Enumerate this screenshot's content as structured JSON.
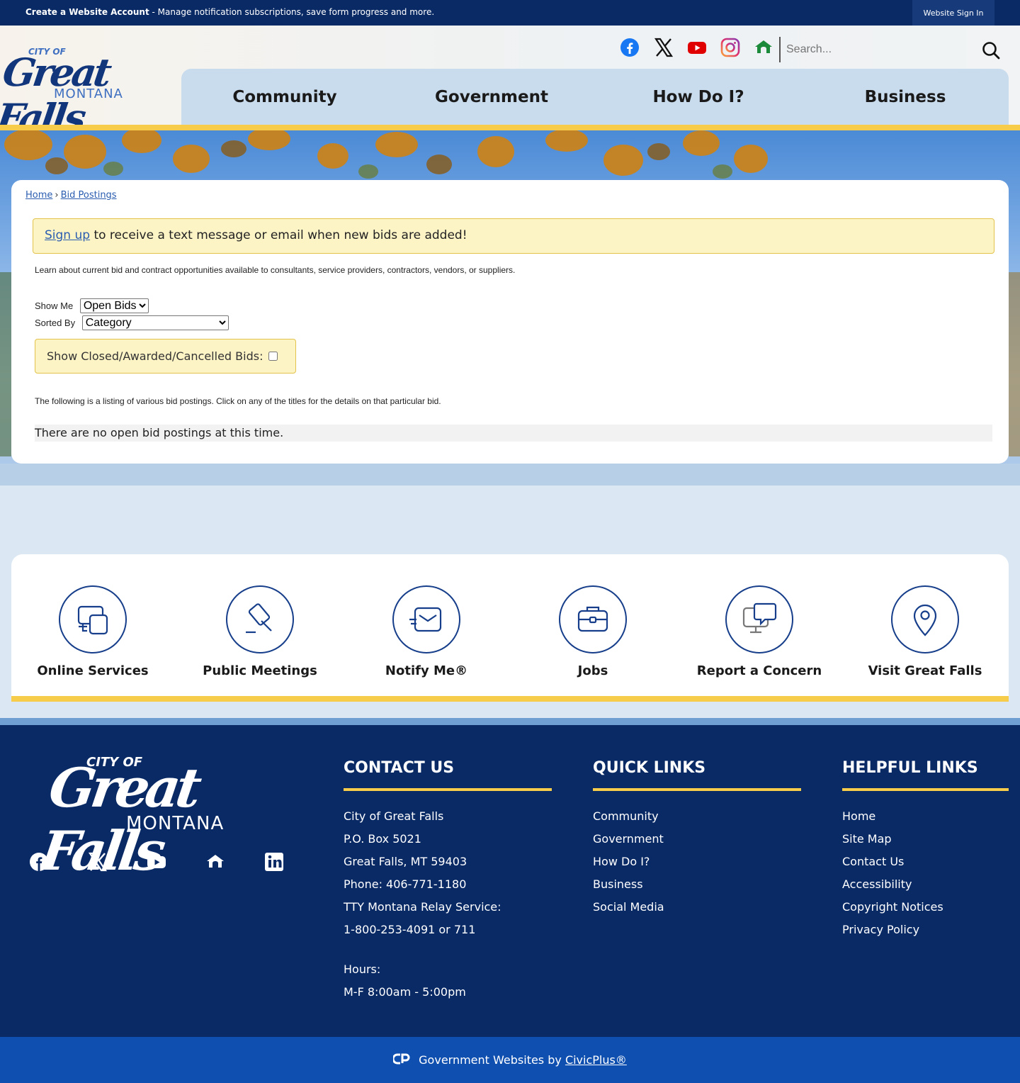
{
  "topbar": {
    "create_account": "Create a Website Account",
    "message": " - Manage notification subscriptions, save form progress and more.",
    "signin": "Website Sign In"
  },
  "logo": {
    "city_of": "CITY OF",
    "name": "Great Falls",
    "state": "MONTANA"
  },
  "social_top": [
    "facebook-icon",
    "x-icon",
    "youtube-icon",
    "instagram-icon",
    "nextdoor-icon"
  ],
  "search": {
    "placeholder": "Search..."
  },
  "nav": {
    "items": [
      "Community",
      "Government",
      "How Do I?",
      "Business"
    ]
  },
  "breadcrumb": {
    "home": "Home",
    "sep": "›",
    "current": "Bid Postings"
  },
  "alert": {
    "link": "Sign up",
    "text": " to receive a text message or email when new bids are added!"
  },
  "intro": "Learn about current bid and contract opportunities available to consultants, service providers, contractors, vendors, or suppliers.",
  "filters": {
    "show_me_label": "Show Me",
    "show_me_value": "Open Bids",
    "sorted_by_label": "Sorted By",
    "sorted_by_value": "Category",
    "closed_label": "Show Closed/Awarded/Cancelled Bids:"
  },
  "listing_text": "The following is a listing of various bid postings. Click on any of the titles for the details on that particular bid.",
  "no_bids": "There are no open bid postings at this time.",
  "quick_links": [
    {
      "label": "Online Services",
      "icon": "devices-icon"
    },
    {
      "label": "Public Meetings",
      "icon": "gavel-icon"
    },
    {
      "label": "Notify Me®",
      "icon": "envelope-icon"
    },
    {
      "label": "Jobs",
      "icon": "briefcase-icon"
    },
    {
      "label": "Report a Concern",
      "icon": "monitor-chat-icon"
    },
    {
      "label": "Visit Great Falls",
      "icon": "map-pin-icon"
    }
  ],
  "footer": {
    "logo": {
      "city_of": "CITY OF",
      "name": "Great Falls",
      "state": "MONTANA"
    },
    "social": [
      "facebook-icon",
      "x-icon",
      "youtube-icon",
      "nextdoor-icon",
      "linkedin-icon"
    ],
    "contact": {
      "title": "CONTACT US",
      "lines": [
        "City of Great Falls",
        "P.O. Box 5021",
        "Great Falls, MT 59403",
        "Phone: 406-771-1180",
        "TTY Montana Relay Service:",
        "1-800-253-4091 or 711"
      ],
      "hours_label": "Hours:",
      "hours": "M-F 8:00am - 5:00pm"
    },
    "quick": {
      "title": "QUICK LINKS",
      "items": [
        "Community",
        "Government",
        "How Do I?",
        "Business",
        "Social Media"
      ]
    },
    "helpful": {
      "title": "HELPFUL LINKS",
      "items": [
        "Home",
        "Site Map",
        "Contact Us",
        "Accessibility",
        "Copyright Notices",
        "Privacy Policy"
      ]
    }
  },
  "civicplus": {
    "text": "Government Websites by ",
    "link": "CivicPlus®"
  },
  "colors": {
    "navy": "#0a2a66",
    "gold": "#f7cc4a",
    "nav_bg": "#c9dcee",
    "link": "#2a5db0"
  }
}
